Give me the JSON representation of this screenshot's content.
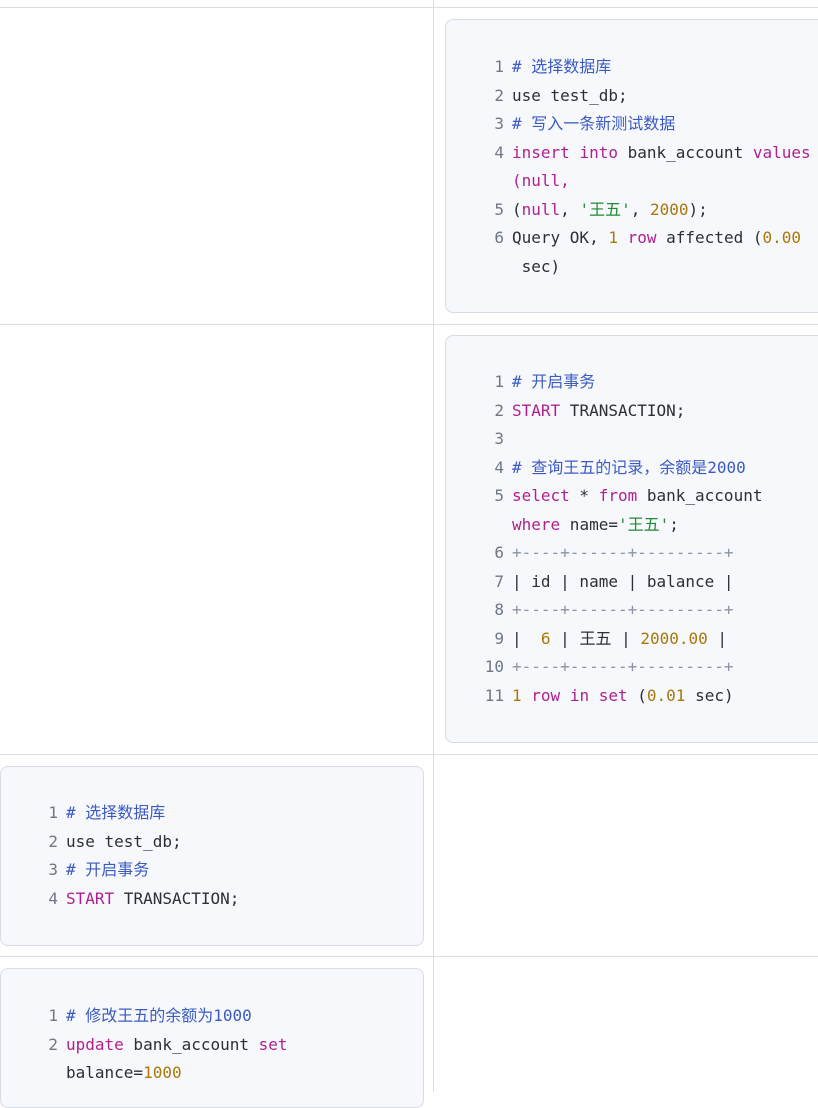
{
  "rows": [
    {
      "code": [
        {
          "n": "1",
          "parts": [
            {
              "t": "# 选择数据库",
              "c": "comment"
            }
          ]
        },
        {
          "n": "2",
          "parts": [
            {
              "t": "use test_db;",
              "c": "plain"
            }
          ]
        },
        {
          "n": "3",
          "parts": [
            {
              "t": "# 写入一条新测试数据",
              "c": "comment"
            }
          ]
        },
        {
          "n": "4",
          "parts": [
            {
              "t": "insert",
              "c": "kw"
            },
            {
              "t": " ",
              "c": "plain"
            },
            {
              "t": "into",
              "c": "kw"
            },
            {
              "t": " bank_account ",
              "c": "plain"
            },
            {
              "t": "values",
              "c": "kw"
            }
          ]
        },
        {
          "n": "",
          "parts": [
            {
              "t": "(null,",
              "c": "kw"
            }
          ]
        },
        {
          "n": "5",
          "parts": [
            {
              "t": "(",
              "c": "plain"
            },
            {
              "t": "null",
              "c": "kw"
            },
            {
              "t": ", ",
              "c": "plain"
            },
            {
              "t": "'王五'",
              "c": "str"
            },
            {
              "t": ", ",
              "c": "plain"
            },
            {
              "t": "2000",
              "c": "num"
            },
            {
              "t": ");",
              "c": "plain"
            }
          ]
        },
        {
          "n": "6",
          "parts": [
            {
              "t": "Query OK, ",
              "c": "plain"
            },
            {
              "t": "1",
              "c": "num"
            },
            {
              "t": " ",
              "c": "plain"
            },
            {
              "t": "row",
              "c": "kw"
            },
            {
              "t": " affected (",
              "c": "plain"
            },
            {
              "t": "0.00",
              "c": "num"
            }
          ]
        },
        {
          "n": "",
          "parts": [
            {
              "t": " sec)",
              "c": "plain"
            }
          ]
        }
      ]
    },
    {
      "code": [
        {
          "n": "1",
          "parts": [
            {
              "t": "# 开启事务",
              "c": "comment"
            }
          ]
        },
        {
          "n": "2",
          "parts": [
            {
              "t": "START",
              "c": "kw"
            },
            {
              "t": " TRANSACTION;",
              "c": "plain"
            }
          ]
        },
        {
          "n": "3",
          "parts": []
        },
        {
          "n": "4",
          "parts": [
            {
              "t": "# 查询王五的记录，余额是2000",
              "c": "comment"
            }
          ]
        },
        {
          "n": "5",
          "parts": [
            {
              "t": "select",
              "c": "kw"
            },
            {
              "t": " * ",
              "c": "plain"
            },
            {
              "t": "from",
              "c": "kw"
            },
            {
              "t": " bank_account",
              "c": "plain"
            }
          ]
        },
        {
          "n": "",
          "parts": [
            {
              "t": "where",
              "c": "kw"
            },
            {
              "t": " name=",
              "c": "plain"
            },
            {
              "t": "'王五'",
              "c": "str"
            },
            {
              "t": ";",
              "c": "plain"
            }
          ]
        },
        {
          "n": "6",
          "parts": [
            {
              "t": "+----+------+---------+",
              "c": "dash"
            }
          ]
        },
        {
          "n": "7",
          "parts": [
            {
              "t": "| id | name | balance |",
              "c": "plain"
            }
          ]
        },
        {
          "n": "8",
          "parts": [
            {
              "t": "+----+------+---------+",
              "c": "dash"
            }
          ]
        },
        {
          "n": "9",
          "parts": [
            {
              "t": "|  ",
              "c": "plain"
            },
            {
              "t": "6",
              "c": "num"
            },
            {
              "t": " | 王五 | ",
              "c": "plain"
            },
            {
              "t": "2000.00",
              "c": "num"
            },
            {
              "t": " |",
              "c": "plain"
            }
          ]
        },
        {
          "n": "10",
          "parts": [
            {
              "t": "+----+------+---------+",
              "c": "dash"
            }
          ]
        },
        {
          "n": "11",
          "parts": [
            {
              "t": "1",
              "c": "num"
            },
            {
              "t": " ",
              "c": "plain"
            },
            {
              "t": "row",
              "c": "kw"
            },
            {
              "t": " ",
              "c": "plain"
            },
            {
              "t": "in",
              "c": "kw"
            },
            {
              "t": " ",
              "c": "plain"
            },
            {
              "t": "set",
              "c": "kw"
            },
            {
              "t": " (",
              "c": "plain"
            },
            {
              "t": "0.01",
              "c": "num"
            },
            {
              "t": " sec)",
              "c": "plain"
            }
          ]
        }
      ]
    },
    {
      "code": [
        {
          "n": "1",
          "parts": [
            {
              "t": "# 选择数据库",
              "c": "comment"
            }
          ]
        },
        {
          "n": "2",
          "parts": [
            {
              "t": "use test_db;",
              "c": "plain"
            }
          ]
        },
        {
          "n": "3",
          "parts": [
            {
              "t": "# 开启事务",
              "c": "comment"
            }
          ]
        },
        {
          "n": "4",
          "parts": [
            {
              "t": "START",
              "c": "kw"
            },
            {
              "t": " TRANSACTION;",
              "c": "plain"
            }
          ]
        }
      ]
    },
    {
      "code": [
        {
          "n": "1",
          "parts": [
            {
              "t": "# 修改王五的余额为1000",
              "c": "comment"
            }
          ]
        },
        {
          "n": "2",
          "parts": [
            {
              "t": "update",
              "c": "kw"
            },
            {
              "t": " bank_account ",
              "c": "plain"
            },
            {
              "t": "set",
              "c": "kw"
            }
          ]
        },
        {
          "n": "",
          "parts": [
            {
              "t": "balance=",
              "c": "plain"
            },
            {
              "t": "1000",
              "c": "num"
            }
          ]
        }
      ]
    }
  ]
}
